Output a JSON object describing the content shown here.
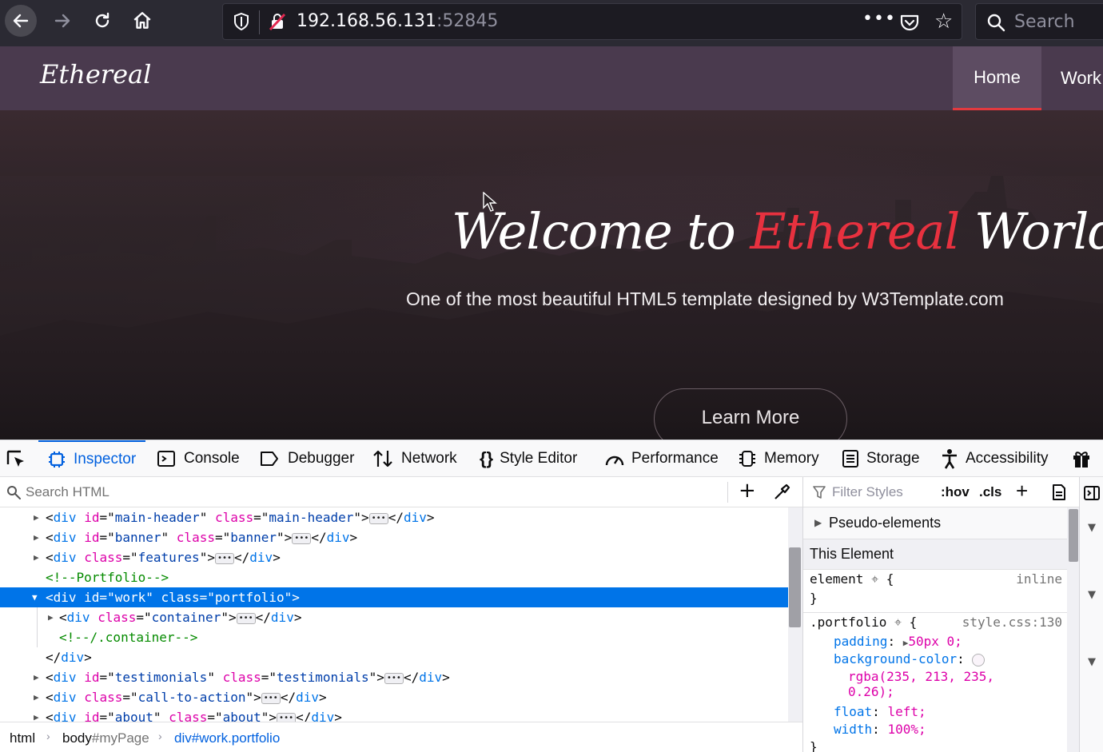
{
  "browser": {
    "url_host": "192.168.56.131",
    "url_port": ":52845",
    "search_placeholder": "Search",
    "more_label": "•••"
  },
  "site": {
    "logo": "Ethereal",
    "nav": {
      "home": "Home",
      "work": "Work"
    },
    "hero": {
      "title_pre": "Welcome to ",
      "title_accent": "Ethereal",
      "title_post": " World",
      "subtitle": "One of the most beautiful HTML5 template designed by W3Template.com",
      "button": "Learn More"
    },
    "colors": {
      "accent": "#e8313f",
      "header_bg": "#4a3a4e"
    }
  },
  "devtools": {
    "tabs": [
      {
        "label": "Inspector",
        "icon": "inspector-icon",
        "active": true
      },
      {
        "label": "Console",
        "icon": "console-icon"
      },
      {
        "label": "Debugger",
        "icon": "debugger-icon"
      },
      {
        "label": "Network",
        "icon": "network-icon"
      },
      {
        "label": "Style Editor",
        "icon": "style-editor-icon"
      },
      {
        "label": "Performance",
        "icon": "performance-icon"
      },
      {
        "label": "Memory",
        "icon": "memory-icon"
      },
      {
        "label": "Storage",
        "icon": "storage-icon"
      },
      {
        "label": "Accessibility",
        "icon": "accessibility-icon"
      }
    ],
    "search_html_placeholder": "Search HTML",
    "markup": [
      {
        "open": "<",
        "tag": "div",
        "attrs": [
          [
            "id",
            "main-header"
          ],
          [
            "class",
            "main-header"
          ]
        ],
        "collapsed": true
      },
      {
        "open": "<",
        "tag": "div",
        "attrs": [
          [
            "id",
            "banner"
          ],
          [
            "class",
            "banner"
          ]
        ],
        "collapsed": true
      },
      {
        "open": "<",
        "tag": "div",
        "attrs": [
          [
            "class",
            "features"
          ]
        ],
        "collapsed": true
      },
      {
        "comment": "<!--Portfolio-->"
      },
      {
        "open": "<",
        "tag": "div",
        "attrs": [
          [
            "id",
            "work"
          ],
          [
            "class",
            "portfolio"
          ]
        ],
        "expanded": true,
        "selected": true
      },
      {
        "open": "<",
        "tag": "div",
        "attrs": [
          [
            "class",
            "container"
          ]
        ],
        "collapsed": true,
        "indent": 1
      },
      {
        "comment": "<!--/.container-->",
        "indent": 1
      },
      {
        "closing": "div"
      },
      {
        "open": "<",
        "tag": "div",
        "attrs": [
          [
            "id",
            "testimonials"
          ],
          [
            "class",
            "testimonials"
          ]
        ],
        "collapsed": true
      },
      {
        "open": "<",
        "tag": "div",
        "attrs": [
          [
            "class",
            "call-to-action"
          ]
        ],
        "collapsed": true
      },
      {
        "open": "<",
        "tag": "div",
        "attrs": [
          [
            "id",
            "about"
          ],
          [
            "class",
            "about"
          ]
        ],
        "collapsed": true
      }
    ],
    "breadcrumbs": [
      {
        "name": "html",
        "hash": ""
      },
      {
        "name": "body",
        "hash": "#myPage"
      },
      {
        "name": "div",
        "hash": "#work.portfolio",
        "active": true
      }
    ],
    "rules": {
      "filter_placeholder": "Filter Styles",
      "hov": ":hov",
      "cls": ".cls",
      "pseudo_elements": "Pseudo-elements",
      "this_element": "This Element",
      "element_selector": "element",
      "element_source": "inline",
      "portfolio_selector": ".portfolio",
      "portfolio_source": "style.css:130",
      "declarations": [
        {
          "prop": "padding",
          "value": "50px 0;"
        },
        {
          "prop": "background-color",
          "value": "rgba(235, 213, 235, 0.26);"
        },
        {
          "prop": "float",
          "value": "left;"
        },
        {
          "prop": "width",
          "value": "100%;"
        }
      ],
      "bg_swatch": "rgba(235,213,235,0.26)"
    }
  }
}
